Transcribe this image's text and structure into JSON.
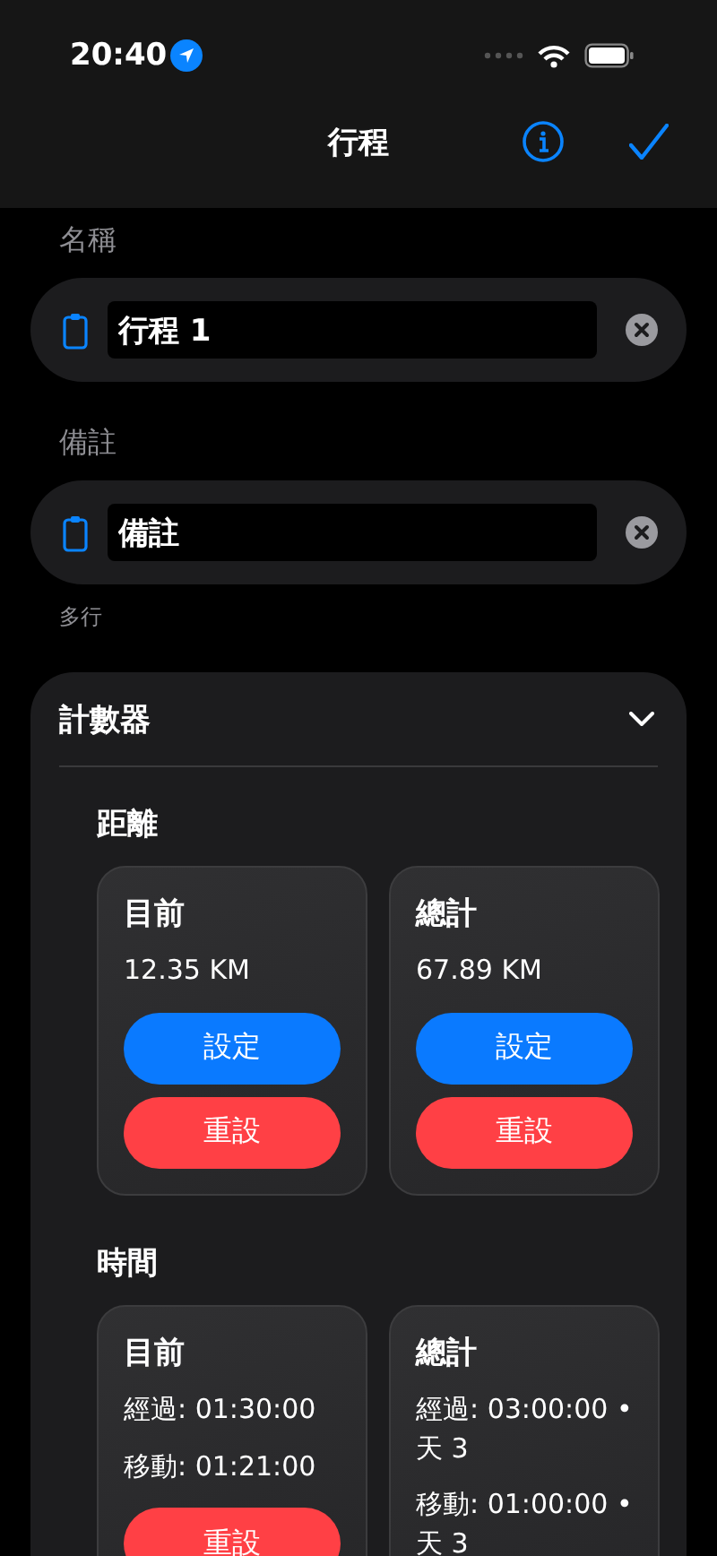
{
  "status_bar": {
    "time": "20:40"
  },
  "nav": {
    "title": "行程"
  },
  "fields": [
    {
      "label": "名稱",
      "value": "行程 1"
    },
    {
      "label": "備註",
      "value": "備註",
      "hint": "多行"
    }
  ],
  "counter": {
    "title": "計數器",
    "expanded": true,
    "groups": [
      {
        "title": "距離",
        "cards": [
          {
            "title": "目前",
            "lines": [
              "12.35 KM"
            ],
            "buttons": [
              {
                "label": "設定",
                "kind": "set"
              },
              {
                "label": "重設",
                "kind": "reset"
              }
            ]
          },
          {
            "title": "總計",
            "lines": [
              "67.89 KM"
            ],
            "buttons": [
              {
                "label": "設定",
                "kind": "set"
              },
              {
                "label": "重設",
                "kind": "reset"
              }
            ]
          }
        ]
      },
      {
        "title": "時間",
        "cards": [
          {
            "title": "目前",
            "lines": [
              "經過: 01:30:00",
              "移動: 01:21:00"
            ],
            "buttons": [
              {
                "label": "重設",
                "kind": "reset"
              }
            ]
          },
          {
            "title": "總計",
            "lines": [
              "經過: 03:00:00 • 天 3",
              "移動: 01:00:00 • 天 3"
            ]
          }
        ]
      }
    ]
  }
}
